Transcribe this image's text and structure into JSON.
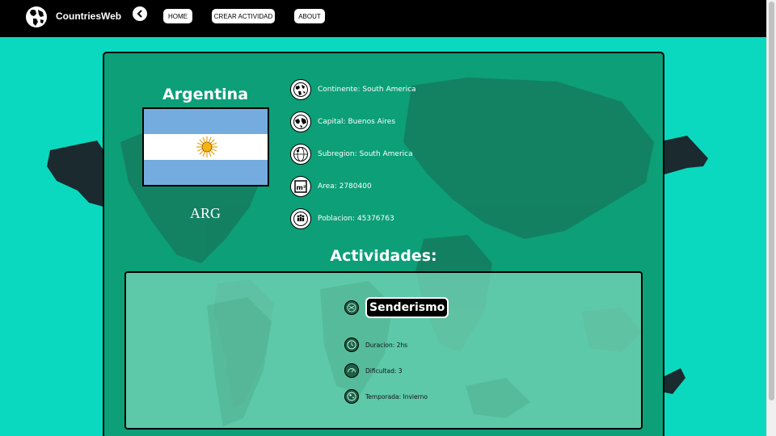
{
  "navbar": {
    "brand": "CountriesWeb",
    "links": [
      "HOME",
      "CREAR ACTIVIDAD",
      "ABOUT"
    ]
  },
  "country": {
    "name": "Argentina",
    "code": "ARG",
    "details": [
      {
        "icon": "globe-icon",
        "text": "Continente: South America"
      },
      {
        "icon": "world-map-icon",
        "text": "Capital: Buenos Aires"
      },
      {
        "icon": "globe-lines-icon",
        "text": "Subregion: South America"
      },
      {
        "icon": "area-m2-icon",
        "text": "Area: 2780400"
      },
      {
        "icon": "population-icon",
        "text": "Poblacion: 45376763"
      }
    ]
  },
  "activities": {
    "title": "Actividades:",
    "items": [
      {
        "name": "Senderismo",
        "duracion": "Duracion: 2hs",
        "dificultad": "Dificultad: 3",
        "temporada": "Temporada: Invierno"
      }
    ]
  },
  "colors": {
    "background": "#0bd9bf",
    "card": "#0d966e",
    "navbar": "#000000"
  }
}
